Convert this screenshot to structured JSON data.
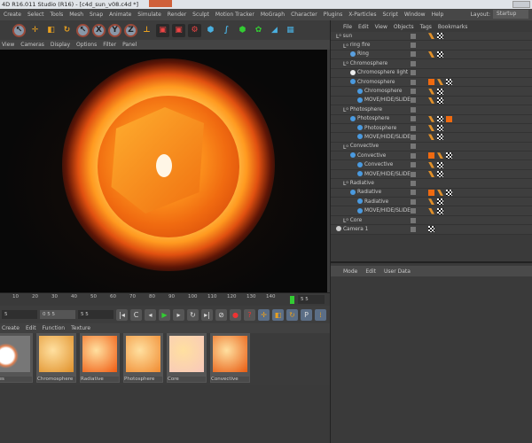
{
  "title": "4D R16.011 Studio (R16) - [c4d_sun_v08.c4d *]",
  "menu": [
    "Create",
    "Select",
    "Tools",
    "Mesh",
    "Snap",
    "Animate",
    "Simulate",
    "Render",
    "Sculpt",
    "Motion Tracker",
    "MoGraph",
    "Character",
    "Plugins",
    "X-Particles",
    "Script",
    "Window",
    "Help"
  ],
  "layout": {
    "label": "Layout:",
    "value": "Startup"
  },
  "toolbar": {
    "x": "X",
    "y": "Y",
    "z": "Z"
  },
  "viewport_menu": [
    "View",
    "Cameras",
    "Display",
    "Options",
    "Filter",
    "Panel"
  ],
  "timeline": {
    "ticks": [
      "10",
      "20",
      "30",
      "40",
      "50",
      "60",
      "70",
      "80",
      "90",
      "100",
      "110",
      "120",
      "130",
      "140"
    ],
    "end": "5 5"
  },
  "transport": {
    "start": "5",
    "current": "0 5 5",
    "end": "5 5"
  },
  "material_menu": [
    "Create",
    "Edit",
    "Function",
    "Texture"
  ],
  "materials": [
    {
      "name": "thes",
      "color": "#fff0e0"
    },
    {
      "name": "Chromosphere",
      "color": "#e0902a"
    },
    {
      "name": "Radiative",
      "color": "#f05a10"
    },
    {
      "name": "Photosphere",
      "color": "#f08a30"
    },
    {
      "name": "Core",
      "color": "#f8c8bc"
    },
    {
      "name": "Convective",
      "color": "#e85a10"
    }
  ],
  "object_menu": [
    "File",
    "Edit",
    "View",
    "Objects",
    "Tags",
    "Bookmarks"
  ],
  "objects": [
    {
      "name": "sun",
      "depth": 0,
      "icon": "null",
      "tags": [
        "p",
        "c"
      ]
    },
    {
      "name": "ring fire",
      "depth": 1,
      "icon": "null",
      "tags": []
    },
    {
      "name": "Ring",
      "depth": 2,
      "icon": "ring",
      "tags": [
        "p",
        "c"
      ]
    },
    {
      "name": "Chromosphere",
      "depth": 1,
      "icon": "null",
      "tags": []
    },
    {
      "name": "Chromosphere light",
      "depth": 2,
      "icon": "light",
      "tags": []
    },
    {
      "name": "Chromosphere",
      "depth": 2,
      "icon": "sphere",
      "tags": [
        "m",
        "p",
        "c"
      ]
    },
    {
      "name": "Chromosphere",
      "depth": 3,
      "icon": "sphere",
      "tags": [
        "p",
        "c"
      ]
    },
    {
      "name": "MOVE/HIDE/SLIDE",
      "depth": 3,
      "icon": "sphere",
      "tags": [
        "p",
        "c"
      ]
    },
    {
      "name": "Photosphere",
      "depth": 1,
      "icon": "null",
      "tags": []
    },
    {
      "name": "Photosphere",
      "depth": 2,
      "icon": "sphere",
      "tags": [
        "p",
        "c",
        "m"
      ]
    },
    {
      "name": "Photosphere",
      "depth": 3,
      "icon": "sphere",
      "tags": [
        "p",
        "c"
      ]
    },
    {
      "name": "MOVE/HIDE/SLIDE",
      "depth": 3,
      "icon": "sphere",
      "tags": [
        "p",
        "c"
      ]
    },
    {
      "name": "Convective",
      "depth": 1,
      "icon": "null",
      "tags": []
    },
    {
      "name": "Convective",
      "depth": 2,
      "icon": "sphere",
      "tags": [
        "m",
        "p",
        "c"
      ]
    },
    {
      "name": "Convective",
      "depth": 3,
      "icon": "sphere",
      "tags": [
        "p",
        "c"
      ]
    },
    {
      "name": "MOVE/HIDE/SLIDE",
      "depth": 3,
      "icon": "sphere",
      "tags": [
        "p",
        "c"
      ]
    },
    {
      "name": "Radiative",
      "depth": 1,
      "icon": "null",
      "tags": []
    },
    {
      "name": "Radiative",
      "depth": 2,
      "icon": "sphere",
      "tags": [
        "m",
        "p",
        "c"
      ]
    },
    {
      "name": "Radiative",
      "depth": 3,
      "icon": "sphere",
      "tags": [
        "p",
        "c"
      ]
    },
    {
      "name": "MOVE/HIDE/SLIDE",
      "depth": 3,
      "icon": "sphere",
      "tags": [
        "p",
        "c"
      ]
    },
    {
      "name": "Core",
      "depth": 1,
      "icon": "null",
      "tags": []
    },
    {
      "name": "Camera 1",
      "depth": 0,
      "icon": "camera",
      "tags": [
        "c"
      ]
    }
  ],
  "attr_menu": [
    "Mode",
    "Edit",
    "User Data"
  ]
}
